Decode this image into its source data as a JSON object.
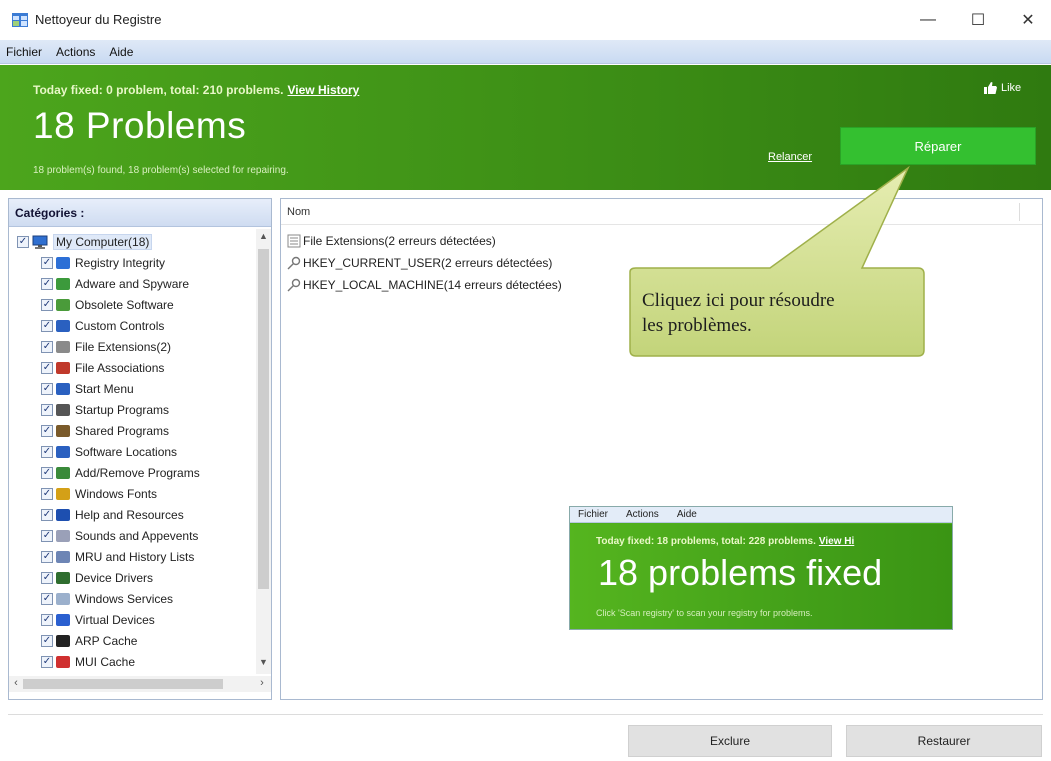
{
  "window": {
    "title": "Nettoyeur du Registre",
    "minimize": "—",
    "maximize": "☐",
    "close": "✕"
  },
  "menu": {
    "items": [
      "Fichier",
      "Actions",
      "Aide"
    ]
  },
  "banner": {
    "today_text": "Today fixed: 0 problem, total: 210 problems.",
    "view_history": "View History",
    "title": "18 Problems",
    "subtext": "18 problem(s) found, 18 problem(s) selected for repairing.",
    "relancer": "Relancer",
    "reparer": "Réparer",
    "like": "Like"
  },
  "categories": {
    "header": "Catégories :",
    "root": "My Computer(18)",
    "items": [
      {
        "label": "Registry Integrity",
        "icon": "registry-icon"
      },
      {
        "label": "Adware and Spyware",
        "icon": "adware-icon"
      },
      {
        "label": "Obsolete Software",
        "icon": "trash-icon"
      },
      {
        "label": "Custom Controls",
        "icon": "controls-icon"
      },
      {
        "label": "File Extensions(2)",
        "icon": "file-extension-icon"
      },
      {
        "label": "File Associations",
        "icon": "file-association-icon"
      },
      {
        "label": "Start Menu",
        "icon": "start-menu-icon"
      },
      {
        "label": "Startup Programs",
        "icon": "startup-icon"
      },
      {
        "label": "Shared Programs",
        "icon": "shared-icon"
      },
      {
        "label": "Software Locations",
        "icon": "software-location-icon"
      },
      {
        "label": "Add/Remove Programs",
        "icon": "add-remove-icon"
      },
      {
        "label": "Windows Fonts",
        "icon": "fonts-icon"
      },
      {
        "label": "Help and Resources",
        "icon": "help-icon"
      },
      {
        "label": "Sounds and Appevents",
        "icon": "sound-icon"
      },
      {
        "label": "MRU and History Lists",
        "icon": "history-icon"
      },
      {
        "label": "Device Drivers",
        "icon": "driver-icon"
      },
      {
        "label": "Windows Services",
        "icon": "services-icon"
      },
      {
        "label": "Virtual Devices",
        "icon": "virtual-device-icon"
      },
      {
        "label": "ARP Cache",
        "icon": "arp-icon"
      },
      {
        "label": "MUI Cache",
        "icon": "mui-icon"
      }
    ]
  },
  "results": {
    "column_header": "Nom",
    "rows": [
      {
        "label": "File Extensions(2 erreurs détectées)",
        "icon": "file-list-icon"
      },
      {
        "label": "HKEY_CURRENT_USER(2 erreurs détectées)",
        "icon": "registry-key-icon"
      },
      {
        "label": "HKEY_LOCAL_MACHINE(14 erreurs détectées)",
        "icon": "registry-key-icon"
      }
    ]
  },
  "callout": {
    "line1": "Cliquez ici pour résoudre",
    "line2": "les problèmes."
  },
  "inset": {
    "menu": [
      "Fichier",
      "Actions",
      "Aide"
    ],
    "today_text": "Today fixed: 18 problems, total: 228 problems.",
    "view_history": "View Hi",
    "title": "18 problems fixed",
    "subtext": "Click 'Scan registry' to scan your registry for problems."
  },
  "bottom": {
    "exclure": "Exclure",
    "restaurer": "Restaurer"
  },
  "colors": {
    "banner_green": "#3d8f16",
    "button_green": "#34c030",
    "callout_fill": "#d6e29a"
  }
}
